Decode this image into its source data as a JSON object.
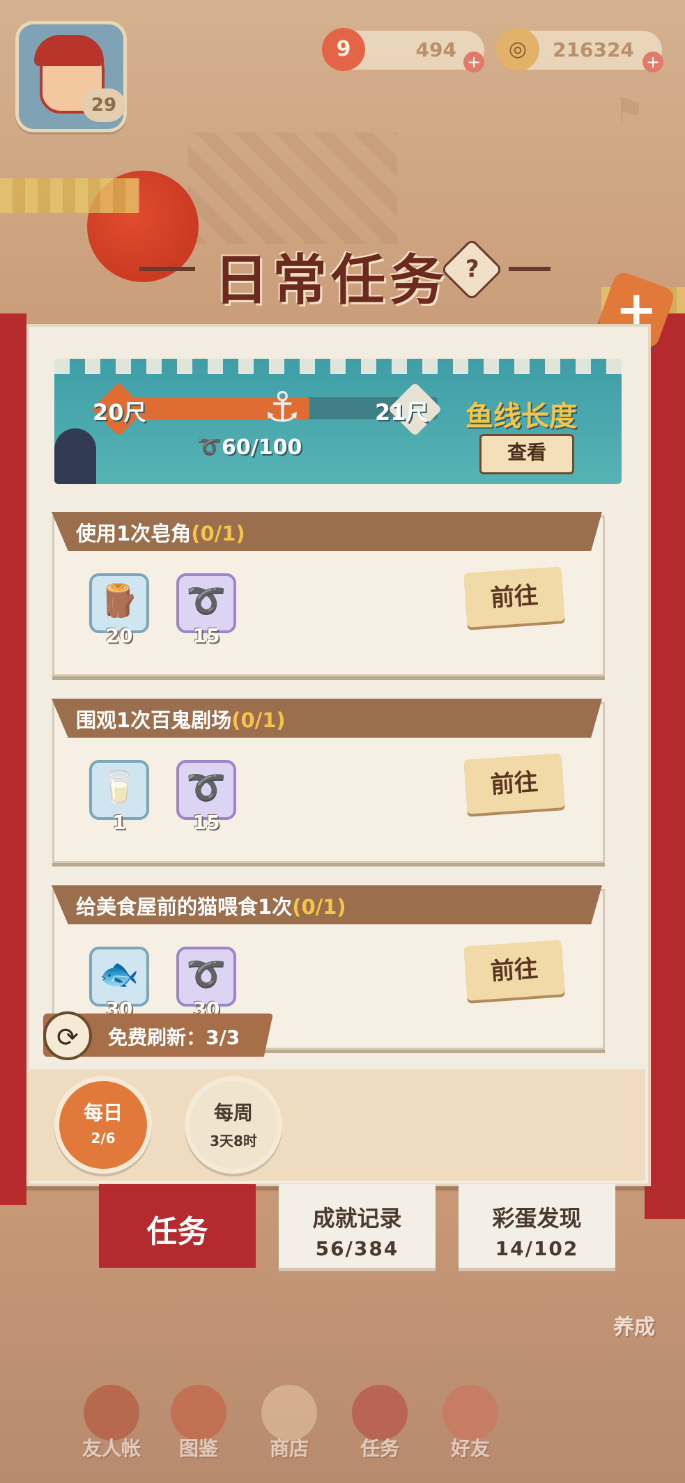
{
  "header": {
    "level": "29",
    "currency_1": {
      "icon": "9",
      "value": "494"
    },
    "currency_2": {
      "icon": "◎",
      "value": "216324"
    }
  },
  "title": "日常任务",
  "help": "?",
  "close": "+",
  "line_banner": {
    "from_length": "20尺",
    "to_length": "21尺",
    "progress_text": "60/100",
    "progress_fraction": 0.6,
    "feature_title": "鱼线长度",
    "view_button": "查看"
  },
  "tasks": [
    {
      "title": "使用1次皂角",
      "progress": "(0/1)",
      "rewards": [
        {
          "icon": "wood-logs-icon",
          "glyph": "🪵",
          "count": "20",
          "style": "blue"
        },
        {
          "icon": "rope-icon",
          "glyph": "➰",
          "count": "15",
          "style": "purple"
        }
      ],
      "button": "前往"
    },
    {
      "title": "围观1次百鬼剧场",
      "progress": "(0/1)",
      "rewards": [
        {
          "icon": "milk-carton-icon",
          "glyph": "🥛",
          "count": "1",
          "style": "blue"
        },
        {
          "icon": "rope-icon",
          "glyph": "➰",
          "count": "15",
          "style": "purple"
        }
      ],
      "button": "前往"
    },
    {
      "title": "给美食屋前的猫喂食1次",
      "progress": "(0/1)",
      "rewards": [
        {
          "icon": "fish-icon",
          "glyph": "🐟",
          "count": "30",
          "style": "blue"
        },
        {
          "icon": "rope-icon",
          "glyph": "➰",
          "count": "30",
          "style": "purple"
        }
      ],
      "button": "前往"
    }
  ],
  "refresh": {
    "label": "免费刷新：3/3"
  },
  "cycles": [
    {
      "label": "每日",
      "sub": "2/6",
      "active": true
    },
    {
      "label": "每周",
      "sub": "3天8时",
      "active": false
    }
  ],
  "categories": [
    {
      "label": "任务",
      "count": "",
      "active": true
    },
    {
      "label": "成就记录",
      "count": "56/384",
      "active": false
    },
    {
      "label": "彩蛋发现",
      "count": "14/102",
      "active": false
    }
  ],
  "nav": [
    {
      "label": "友人帐"
    },
    {
      "label": "图鉴"
    },
    {
      "label": "商店"
    },
    {
      "label": "任务"
    },
    {
      "label": "好友"
    }
  ],
  "side_button": "养成",
  "colors": {
    "accent": "#e0793a",
    "banner_red": "#b52a2e",
    "gold": "#f5c54a",
    "teal": "#3f9ea6"
  }
}
